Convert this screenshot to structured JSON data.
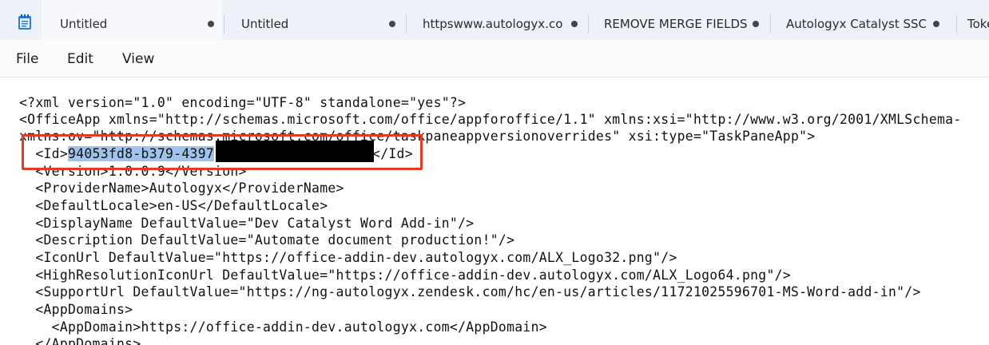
{
  "tabs": [
    {
      "title": "Untitled",
      "modified": true,
      "active": true
    },
    {
      "title": "Untitled",
      "modified": true,
      "active": false
    },
    {
      "title": "httpswww.autologyx.co",
      "modified": true,
      "active": false
    },
    {
      "title": "REMOVE MERGE FIELDS",
      "modified": true,
      "active": false
    },
    {
      "title": "Autologyx Catalyst  SSC",
      "modified": true,
      "active": false
    },
    {
      "title": "Toke",
      "modified": false,
      "active": false
    }
  ],
  "menu": {
    "file": "File",
    "edit": "Edit",
    "view": "View"
  },
  "lines": [
    "<?xml version=\"1.0\" encoding=\"UTF-8\" standalone=\"yes\"?>",
    "<OfficeApp xmlns=\"http://schemas.microsoft.com/office/appforoffice/1.1\" xmlns:xsi=\"http://www.w3.org/2001/XMLSchema-",
    "xmlns:ov=\"http://schemas.microsoft.com/office/taskpaneappversionoverrides\" xsi:type=\"TaskPaneApp\">",
    "",
    "  <Version>1.0.0.9</Version>",
    "  <ProviderName>Autologyx</ProviderName>",
    "  <DefaultLocale>en-US</DefaultLocale>",
    "  <DisplayName DefaultValue=\"Dev Catalyst Word Add-in\"/>",
    "  <Description DefaultValue=\"Automate document production!\"/>",
    "  <IconUrl DefaultValue=\"https://office-addin-dev.autologyx.com/ALX_Logo32.png\"/>",
    "  <HighResolutionIconUrl DefaultValue=\"https://office-addin-dev.autologyx.com/ALX_Logo64.png\"/>",
    "  <SupportUrl DefaultValue=\"https://ng-autologyx.zendesk.com/hc/en-us/articles/11721025596701-MS-Word-add-in\"/>",
    "  <AppDomains>",
    "    <AppDomain>https://office-addin-dev.autologyx.com</AppDomain>",
    "  </AppDomains>"
  ],
  "id_line": {
    "open_tag": "  <Id>",
    "selected_value": "94053fd8-b379-4397",
    "close_tag": "</Id>"
  }
}
